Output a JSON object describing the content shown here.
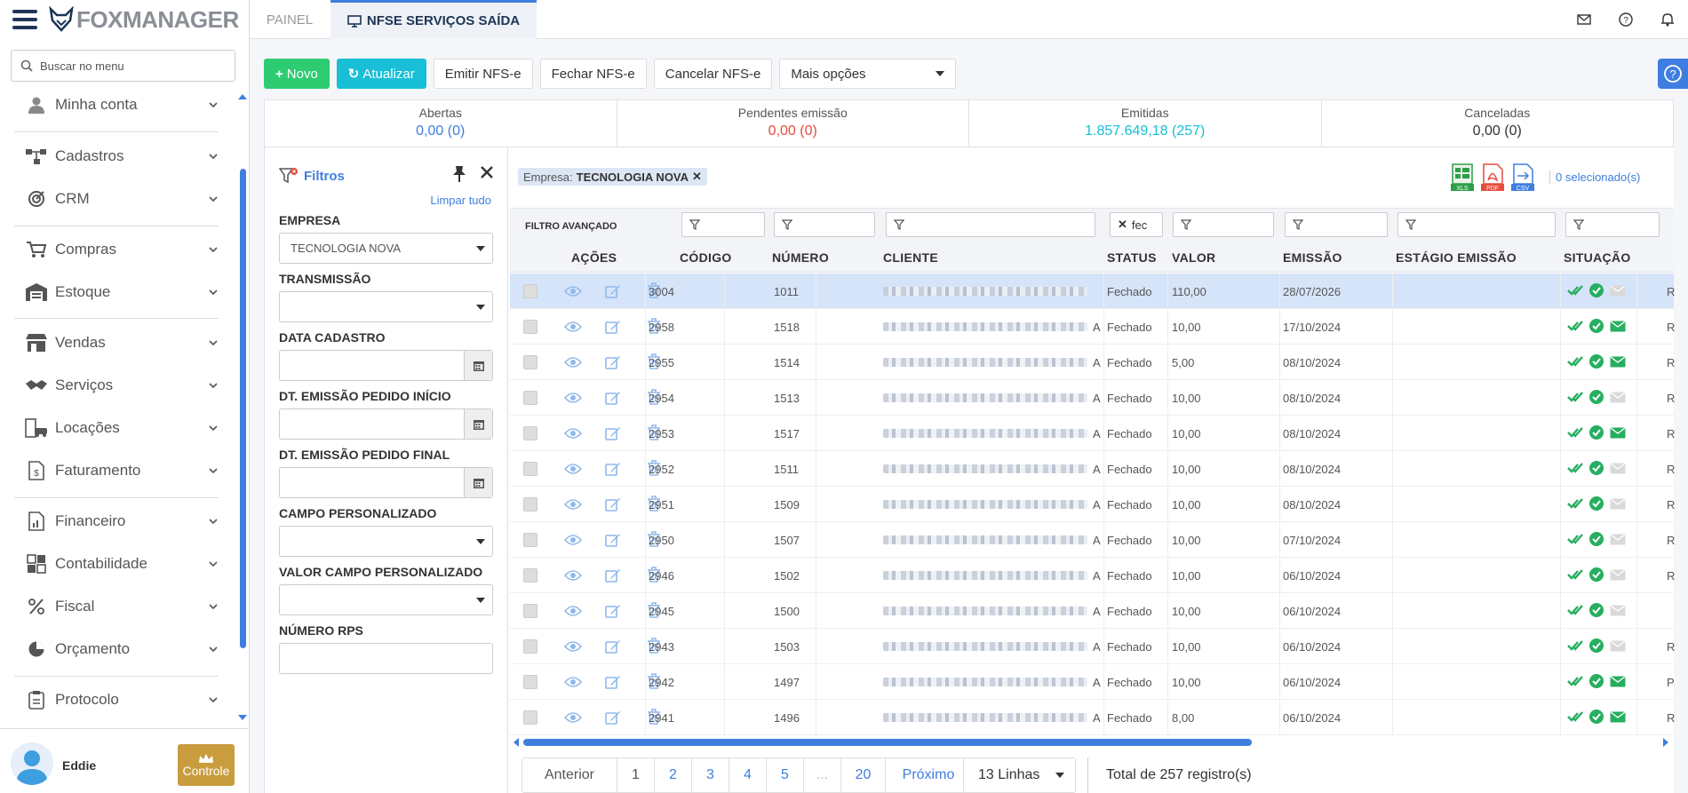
{
  "app": {
    "brand": "FOXMANAGER"
  },
  "sidebar": {
    "search_placeholder": "Buscar no menu",
    "items": [
      {
        "label": "Minha conta",
        "icon": "user-icon"
      },
      {
        "label": "Cadastros",
        "icon": "sitemap-icon"
      },
      {
        "label": "CRM",
        "icon": "target-icon"
      },
      {
        "label": "Compras",
        "icon": "cart-icon"
      },
      {
        "label": "Estoque",
        "icon": "warehouse-icon"
      },
      {
        "label": "Vendas",
        "icon": "store-icon"
      },
      {
        "label": "Serviços",
        "icon": "handshake-icon"
      },
      {
        "label": "Locações",
        "icon": "building-car-icon"
      },
      {
        "label": "Faturamento",
        "icon": "invoice-dollar-icon"
      },
      {
        "label": "Financeiro",
        "icon": "report-chart-icon"
      },
      {
        "label": "Contabilidade",
        "icon": "calculator-icon"
      },
      {
        "label": "Fiscal",
        "icon": "percent-icon"
      },
      {
        "label": "Orçamento",
        "icon": "pie-chart-icon"
      },
      {
        "label": "Protocolo",
        "icon": "clipboard-icon"
      }
    ],
    "user": {
      "name": "Eddie"
    },
    "controle_label": "Controle"
  },
  "tabs": [
    {
      "label": "PAINEL"
    },
    {
      "label": "NFSE SERVIÇOS SAÍDA"
    }
  ],
  "toolbar": {
    "novo": "Novo",
    "atualizar": "Atualizar",
    "emitir": "Emitir NFS-e",
    "fechar": "Fechar NFS-e",
    "cancelar": "Cancelar NFS-e",
    "mais_opcoes": "Mais opções"
  },
  "summary": [
    {
      "label": "Abertas",
      "value": "0,00 (0)",
      "color": "#3f7ee0"
    },
    {
      "label": "Pendentes emissão",
      "value": "0,00 (0)",
      "color": "#e74c3c"
    },
    {
      "label": "Emitidas",
      "value": "1.857.649,18 (257)",
      "color": "#18bfd6"
    },
    {
      "label": "Canceladas",
      "value": "0,00 (0)",
      "color": "#333333"
    }
  ],
  "filters": {
    "title": "Filtros",
    "clear_all": "Limpar tudo",
    "empresa_label": "EMPRESA",
    "empresa_value": "TECNOLOGIA NOVA",
    "transmissao_label": "TRANSMISSÃO",
    "data_cadastro_label": "DATA CADASTRO",
    "dt_inicio_label": "DT. EMISSÃO PEDIDO INÍCIO",
    "dt_final_label": "DT. EMISSÃO PEDIDO FINAL",
    "campo_label": "CAMPO PERSONALIZADO",
    "valor_campo_label": "VALOR CAMPO PERSONALIZADO",
    "rps_label": "NÚMERO RPS"
  },
  "grid": {
    "chip_key": "Empresa:",
    "chip_value": "TECNOLOGIA NOVA",
    "selected": "0 selecionado(s)",
    "advanced_label": "FILTRO AVANÇADO",
    "status_filter": "fec",
    "export_xls": "XLS",
    "export_pdf": "PDF",
    "export_csv": "CSV",
    "headers": {
      "acoes": "AÇÕES",
      "codigo": "CÓDIGO",
      "numero": "NÚMERO",
      "cliente": "CLIENTE",
      "status": "STATUS",
      "valor": "VALOR",
      "emissao": "EMISSÃO",
      "estagio": "ESTÁGIO EMISSÃO",
      "situacao": "SITUAÇÃO"
    },
    "rows": [
      {
        "codigo": "3004",
        "numero": "1011",
        "status": "Fechado",
        "valor": "110,00",
        "emissao": "28/07/2026",
        "tail": "",
        "extra": "R",
        "email": "gray"
      },
      {
        "codigo": "2958",
        "numero": "1518",
        "status": "Fechado",
        "valor": "10,00",
        "emissao": "17/10/2024",
        "tail": "A",
        "extra": "R",
        "email": "green"
      },
      {
        "codigo": "2955",
        "numero": "1514",
        "status": "Fechado",
        "valor": "5,00",
        "emissao": "08/10/2024",
        "tail": "A",
        "extra": "R",
        "email": "green"
      },
      {
        "codigo": "2954",
        "numero": "1513",
        "status": "Fechado",
        "valor": "10,00",
        "emissao": "08/10/2024",
        "tail": "A",
        "extra": "R",
        "email": "gray"
      },
      {
        "codigo": "2953",
        "numero": "1517",
        "status": "Fechado",
        "valor": "10,00",
        "emissao": "08/10/2024",
        "tail": "A",
        "extra": "R",
        "email": "green"
      },
      {
        "codigo": "2952",
        "numero": "1511",
        "status": "Fechado",
        "valor": "10,00",
        "emissao": "08/10/2024",
        "tail": "A",
        "extra": "R",
        "email": "gray"
      },
      {
        "codigo": "2951",
        "numero": "1509",
        "status": "Fechado",
        "valor": "10,00",
        "emissao": "08/10/2024",
        "tail": "A",
        "extra": "R",
        "email": "gray"
      },
      {
        "codigo": "2950",
        "numero": "1507",
        "status": "Fechado",
        "valor": "10,00",
        "emissao": "07/10/2024",
        "tail": "A",
        "extra": "R",
        "email": "gray"
      },
      {
        "codigo": "2946",
        "numero": "1502",
        "status": "Fechado",
        "valor": "10,00",
        "emissao": "06/10/2024",
        "tail": "A",
        "extra": "R",
        "email": "gray"
      },
      {
        "codigo": "2945",
        "numero": "1500",
        "status": "Fechado",
        "valor": "10,00",
        "emissao": "06/10/2024",
        "tail": "A",
        "extra": "",
        "email": "gray"
      },
      {
        "codigo": "2943",
        "numero": "1503",
        "status": "Fechado",
        "valor": "10,00",
        "emissao": "06/10/2024",
        "tail": "A",
        "extra": "R",
        "email": "gray"
      },
      {
        "codigo": "2942",
        "numero": "1497",
        "status": "Fechado",
        "valor": "10,00",
        "emissao": "06/10/2024",
        "tail": "A",
        "extra": "P",
        "email": "green"
      },
      {
        "codigo": "2941",
        "numero": "1496",
        "status": "Fechado",
        "valor": "8,00",
        "emissao": "06/10/2024",
        "tail": "A",
        "extra": "R",
        "email": "green"
      }
    ]
  },
  "pagination": {
    "prev": "Anterior",
    "pages": [
      "1",
      "2",
      "3",
      "4",
      "5",
      "...",
      "20"
    ],
    "next": "Próximo",
    "rows_per_page": "13 Linhas",
    "total": "Total de 257 registro(s)"
  }
}
